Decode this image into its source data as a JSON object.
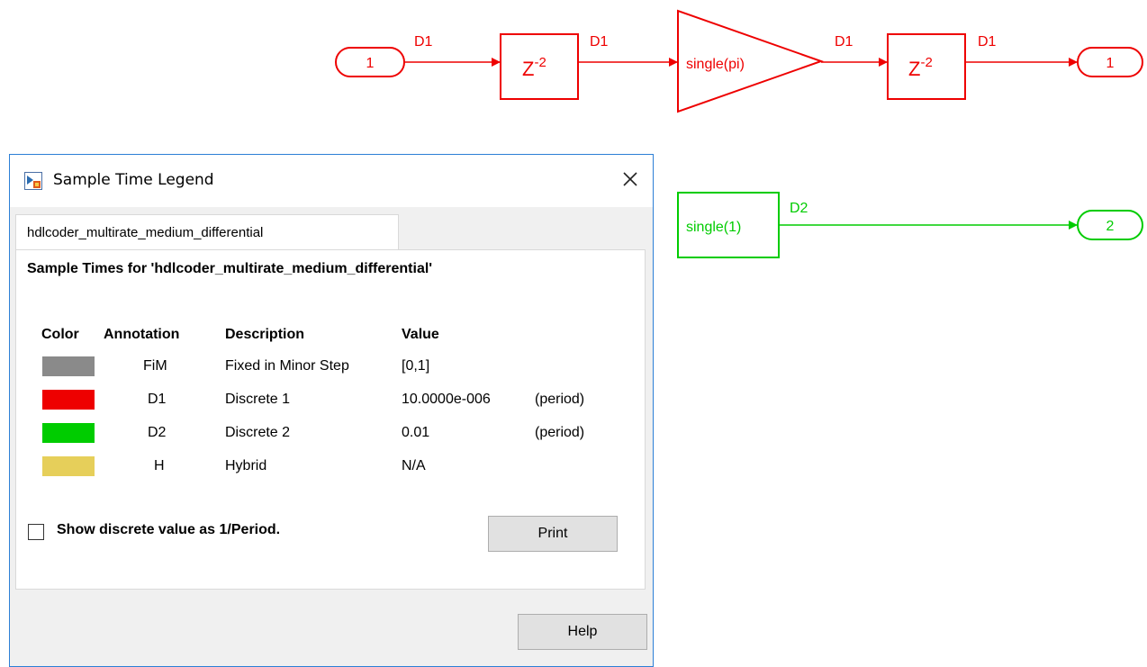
{
  "diagram": {
    "colors": {
      "d1": "#ee0000",
      "d2": "#00cc00"
    },
    "inport1_label": "1",
    "delay_base": "Z",
    "delay_exp": "-2",
    "gain_label": "single(pi)",
    "outport1_label": "1",
    "const_label": "single(1)",
    "outport2_label": "2",
    "sig_d1": "D1",
    "sig_d2": "D2"
  },
  "dialog": {
    "title": "Sample Time Legend",
    "tab_label": "hdlcoder_multirate_medium_differential",
    "heading": "Sample Times for 'hdlcoder_multirate_medium_differential'",
    "columns": {
      "color": "Color",
      "annotation": "Annotation",
      "description": "Description",
      "value": "Value"
    },
    "rows": [
      {
        "color": "#8a8a8a",
        "annotation": "FiM",
        "description": "Fixed in Minor Step",
        "value": "[0,1]",
        "note": ""
      },
      {
        "color": "#ee0000",
        "annotation": "D1",
        "description": "Discrete 1",
        "value": "10.0000e-006",
        "note": "(period)"
      },
      {
        "color": "#00cc00",
        "annotation": "D2",
        "description": "Discrete 2",
        "value": "0.01",
        "note": "(period)"
      },
      {
        "color": "#e6cf5a",
        "annotation": "H",
        "description": "Hybrid",
        "value": "N/A",
        "note": ""
      }
    ],
    "checkbox_label": "Show discrete value as 1/Period.",
    "print_label": "Print",
    "help_label": "Help"
  }
}
